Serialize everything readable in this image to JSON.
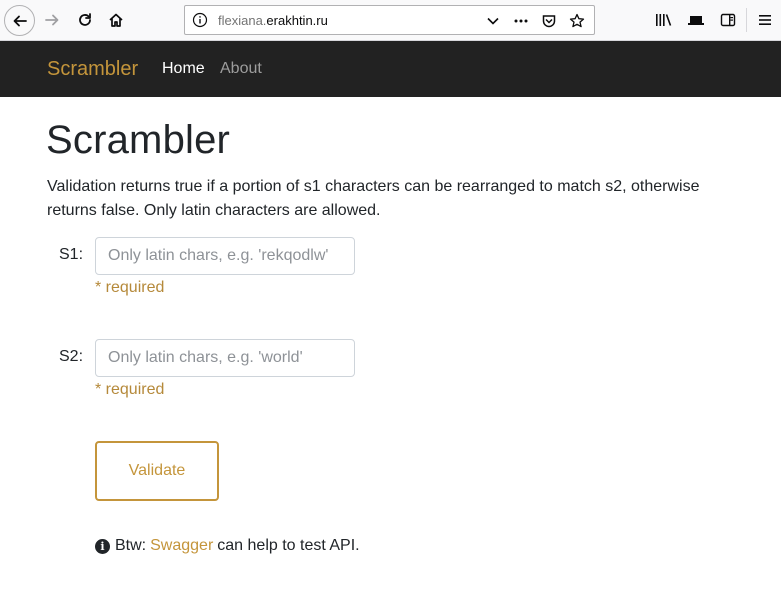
{
  "browser": {
    "url_prefix": "flexiana.",
    "url_domain": "erakhtin.ru",
    "icons": {
      "back": "back-arrow-icon",
      "forward": "forward-arrow-icon",
      "reload": "reload-icon",
      "home": "home-icon",
      "info": "info-icon",
      "dropdown": "chevron-down-icon",
      "more": "more-dots-icon",
      "pocket": "pocket-icon",
      "bookmark": "star-icon",
      "library": "library-icon",
      "synced": "synced-tabs-icon",
      "sidebar": "sidebar-icon",
      "menu": "hamburger-menu-icon"
    }
  },
  "navbar": {
    "brand": "Scrambler",
    "links": [
      {
        "label": "Home",
        "active": true
      },
      {
        "label": "About",
        "active": false
      }
    ]
  },
  "main": {
    "title": "Scrambler",
    "description": "Validation returns true if a portion of s1 characters can be rearranged to match s2, otherwise returns false. Only latin characters are allowed.",
    "fields": [
      {
        "label": "S1:",
        "value": "",
        "placeholder": "Only latin chars, e.g. 'rekqodlw'",
        "error": "* required"
      },
      {
        "label": "S2:",
        "value": "",
        "placeholder": "Only latin chars, e.g. 'world'",
        "error": "* required"
      }
    ],
    "submit_label": "Validate",
    "footer": {
      "prefix": "Btw:",
      "link_text": "Swagger",
      "suffix": "can help to test API."
    }
  },
  "colors": {
    "accent": "#c4953b",
    "navbar_bg": "#222222",
    "nav_inactive": "#9d9d9d"
  }
}
